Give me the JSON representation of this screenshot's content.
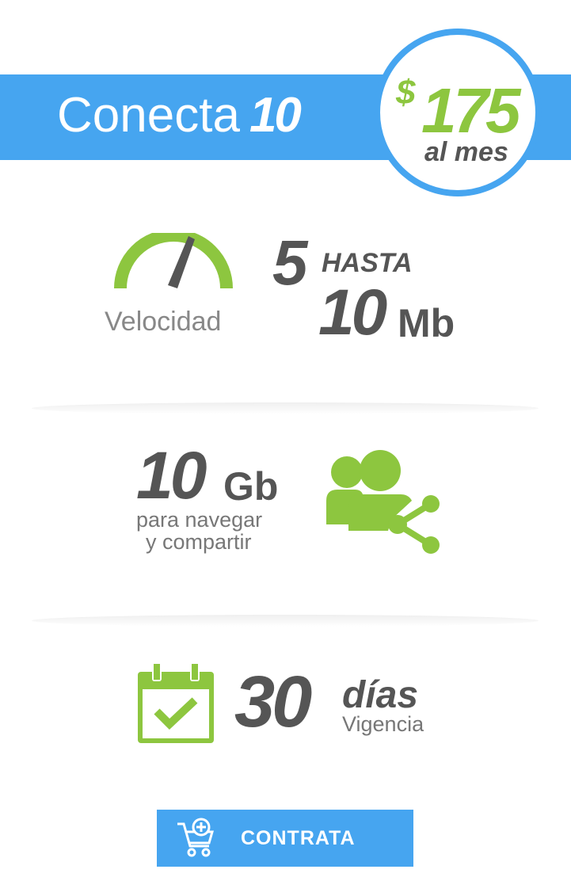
{
  "plan": {
    "name": "Conecta",
    "number": "10"
  },
  "price": {
    "currency": "$",
    "amount": "175",
    "period": "al mes"
  },
  "speed": {
    "label": "Velocidad",
    "min": "5",
    "hasta": "HASTA",
    "max": "10",
    "unit": "Mb",
    "icon": "speedometer-icon"
  },
  "data": {
    "amount": "10",
    "unit": "Gb",
    "line1": "para navegar",
    "line2": "y compartir",
    "icon": "users-share-icon"
  },
  "validity": {
    "number": "30",
    "unit": "días",
    "label": "Vigencia",
    "icon": "calendar-check-icon"
  },
  "cta": {
    "label": "CONTRATA",
    "icon": "cart-add-icon"
  },
  "colors": {
    "blue": "#46a5f0",
    "green": "#8dc63f",
    "dark": "#555555",
    "gray": "#888888"
  }
}
